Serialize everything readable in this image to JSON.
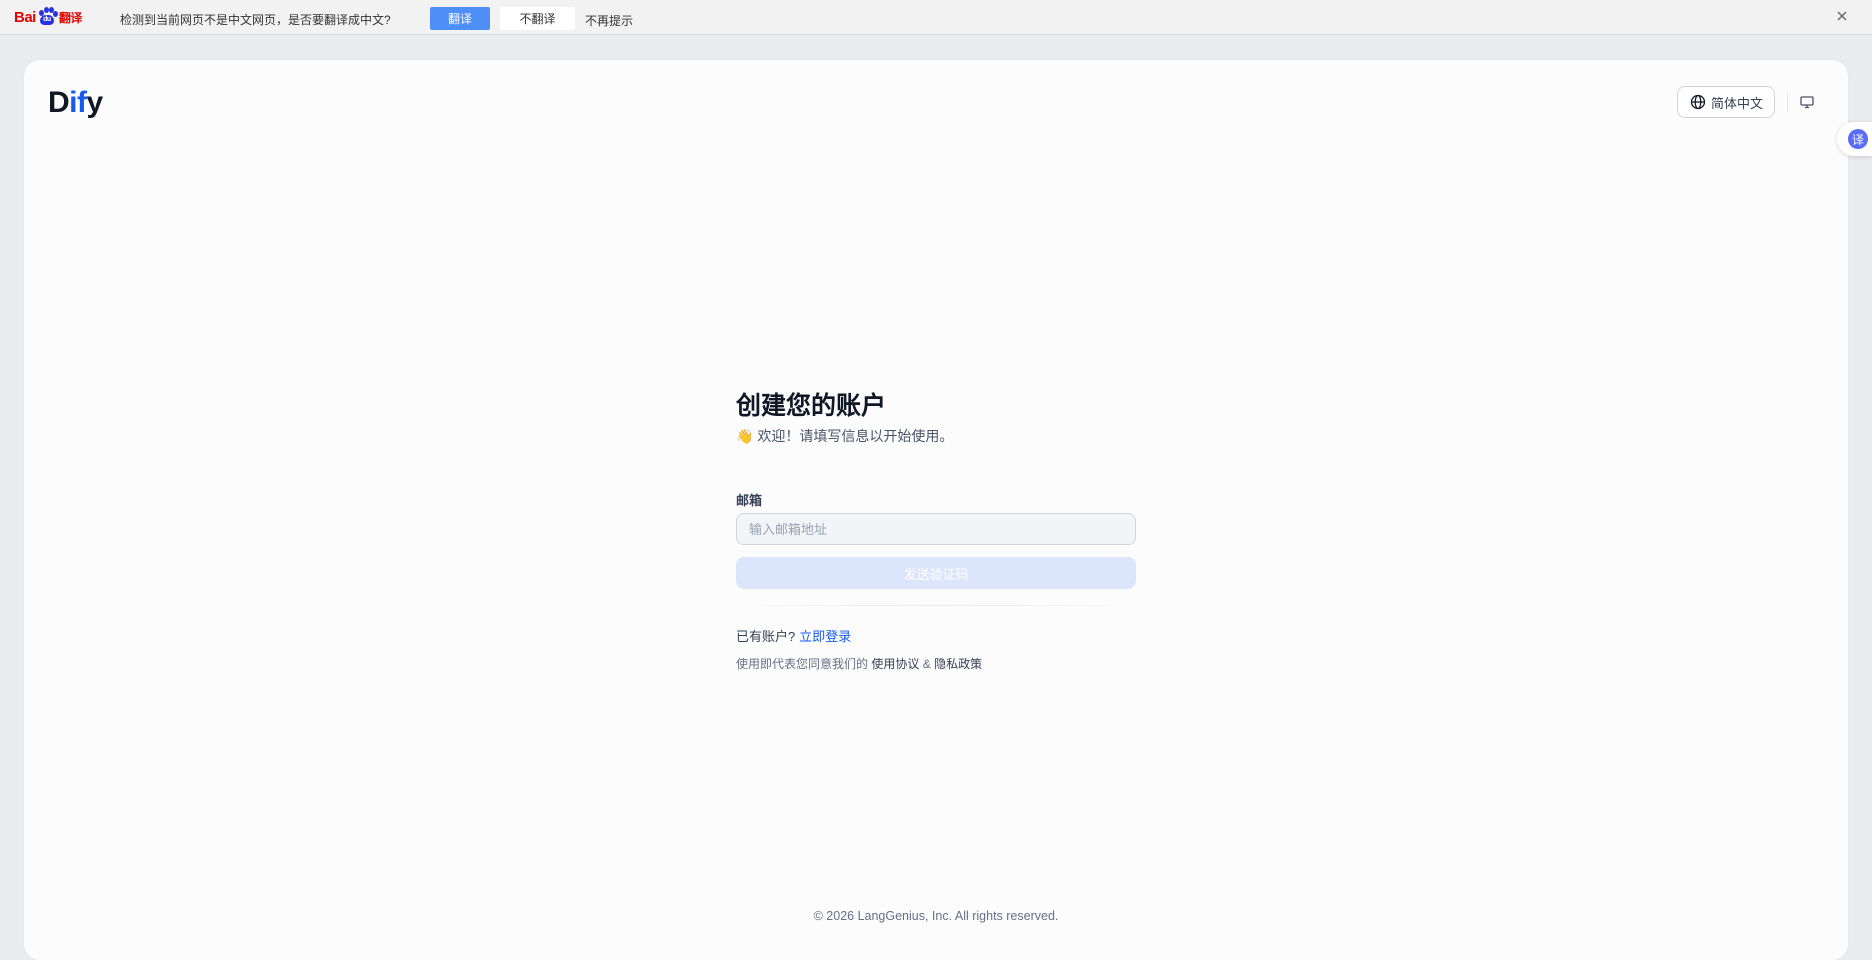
{
  "translate_bar": {
    "logo_bai": "Bai",
    "logo_du": "du",
    "logo_fy": "翻译",
    "message": "检测到当前网页不是中文网页，是否要翻译成中文?",
    "translate_label": "翻译",
    "no_translate_label": "不翻译",
    "never_label": "不再提示"
  },
  "header": {
    "brand_d": "D",
    "brand_if": "if",
    "brand_y": "y",
    "language_label": "简体中文"
  },
  "side_widget": {
    "label": "译"
  },
  "form": {
    "title": "创建您的账户",
    "wave_emoji": "👋",
    "subtitle": "欢迎！请填写信息以开始使用。",
    "email_label": "邮箱",
    "email_placeholder": "输入邮箱地址",
    "email_value": "",
    "send_code_label": "发送验证码",
    "have_account_text": "已有账户?",
    "login_link": "立即登录",
    "terms_prefix": "使用即代表您同意我们的",
    "terms_link": "使用协议",
    "terms_and": "&",
    "privacy_link": "隐私政策"
  },
  "footer": {
    "copyright": "© 2026 LangGenius, Inc. All rights reserved."
  },
  "colors": {
    "accent": "#155aef",
    "send_disabled_bg": "#dbe6fd",
    "baidu_blue_button": "#4e8ef7"
  }
}
